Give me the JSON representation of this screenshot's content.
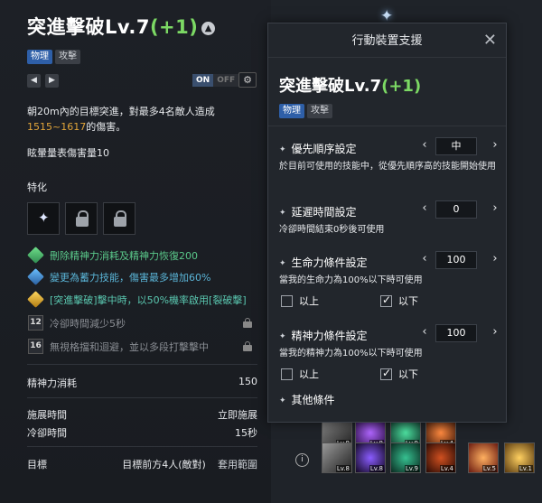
{
  "skill": {
    "title": "突進擊破Lv.7",
    "plus": "(+1)",
    "tags": [
      "物理",
      "攻擊"
    ],
    "on_label": "ON",
    "off_label": "OFF",
    "desc_line1": "朝20m內的目標突進，對最多4名敵人造成",
    "desc_damage": "1515~1617",
    "desc_line2_suffix": "的傷害。",
    "stagger": "眩暈量表傷害量10",
    "special_label": "特化",
    "tripods": [
      {
        "text": "刪除精神力消耗及精神力恢復200"
      },
      {
        "text": "變更為蓄力技能，傷害最多增加60%"
      },
      {
        "text": "[突進擊破]擊中時，以50%機率啟用[裂破擊]"
      },
      {
        "level": "12",
        "text": "冷卻時間減少5秒"
      },
      {
        "level": "16",
        "text": "無視格擋和迴避，並以多段打擊擊中"
      }
    ],
    "mp_label": "精神力消耗",
    "mp_value": "150",
    "cast_label": "施展時間",
    "cast_value": "立即施展",
    "cd_label": "冷卻時間",
    "cd_value": "15秒",
    "target_label": "目標",
    "target_value": "目標前方4人(敵對)",
    "range_label": "套用範圍"
  },
  "modal": {
    "header": "行動裝置支援",
    "title": "突進擊破Lv.7",
    "plus": "(+1)",
    "tags": [
      "物理",
      "攻擊"
    ],
    "settings": [
      {
        "label": "優先順序設定",
        "value": "中",
        "help": "於目前可使用的技能中，從優先順序高的技能開始使用"
      },
      {
        "label": "延遲時間設定",
        "value": "0",
        "help": "冷卻時間結束0秒後可使用"
      },
      {
        "label": "生命力條件設定",
        "value": "100",
        "help": "當我的生命力為100%以下時可使用",
        "above": "以上",
        "below": "以下"
      },
      {
        "label": "精神力條件設定",
        "value": "100",
        "help": "當我的精神力為100%以下時可使用",
        "above": "以上",
        "below": "以下"
      },
      {
        "label": "其他條件"
      }
    ]
  },
  "quickbar": {
    "row1": [
      "Lv.8",
      "Lv.8",
      "Lv.9",
      "Lv.4"
    ],
    "row2": [
      "Lv.8",
      "Lv.8",
      "Lv.9",
      "Lv.4",
      "Lv.5",
      "Lv.1"
    ]
  },
  "colors": {
    "accent_green": "#7cd964",
    "damage_orange": "#e0a43a",
    "tag_blue": "#2e5fa8"
  }
}
